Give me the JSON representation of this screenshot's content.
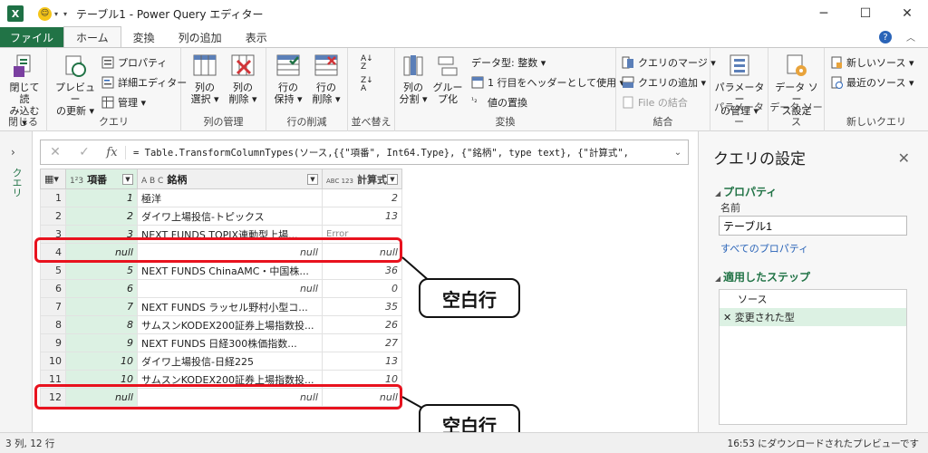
{
  "window": {
    "title": "テーブル1 - Power Query エディター",
    "min": "─",
    "max": "☐",
    "close": "✕"
  },
  "tabs": [
    {
      "label": "ファイル"
    },
    {
      "label": "ホーム"
    },
    {
      "label": "変換"
    },
    {
      "label": "列の追加"
    },
    {
      "label": "表示"
    }
  ],
  "help": "?",
  "ribbon": {
    "groups": {
      "close": "閉じる",
      "query": "クエリ",
      "manage_cols": "列の管理",
      "reduce_rows": "行の削減",
      "sort": "並べ替え",
      "transform": "変換",
      "combine": "結合",
      "params": "パラメーター",
      "datasource": "データ ソース",
      "newquery": "新しいクエリ"
    },
    "close_load": [
      "閉じて読",
      "み込む ▾"
    ],
    "preview": [
      "プレビュー",
      "の更新 ▾"
    ],
    "properties": "プロパティ",
    "advanced_editor": "詳細エディター",
    "manage": "管理 ▾",
    "choose_cols": [
      "列の",
      "選択 ▾"
    ],
    "remove_cols": [
      "列の",
      "削除 ▾"
    ],
    "keep_rows": [
      "行の",
      "保持 ▾"
    ],
    "remove_rows": [
      "行の",
      "削除 ▾"
    ],
    "split_col": [
      "列の",
      "分割 ▾"
    ],
    "group_by": [
      "グルー",
      "プ化"
    ],
    "data_type": "データ型: 整数 ▾",
    "first_row_header": "1 行目をヘッダーとして使用 ▾",
    "replace_values": "値の置換",
    "merge_queries": "クエリのマージ ▾",
    "append_queries": "クエリの追加 ▾",
    "combine_files": "File の結合",
    "manage_params": [
      "パラメーター",
      "の管理 ▾"
    ],
    "ds_settings": [
      "データ ソー",
      "ス設定"
    ],
    "new_source": "新しいソース ▾",
    "recent_sources": "最近のソース ▾"
  },
  "left_pane": {
    "label": "クエリ",
    "chevron": "›"
  },
  "formula": {
    "cancel": "✕",
    "confirm": "✓",
    "fx": "fx",
    "text": "= Table.TransformColumnTypes(ソース,{{\"項番\", Int64.Type}, {\"銘柄\", type text}, {\"計算式\",",
    "expand": "⌄"
  },
  "grid": {
    "columns": [
      {
        "type_icon": "1²3",
        "name": "項番"
      },
      {
        "type_icon": "A B C",
        "name": "銘柄"
      },
      {
        "type_icon": "ABC 123",
        "name": "計算式"
      }
    ],
    "rows": [
      {
        "n": "1",
        "a": "1",
        "b": "極洋",
        "c": "2"
      },
      {
        "n": "2",
        "a": "2",
        "b": "ダイワ上場投信-トピックス",
        "c": "13"
      },
      {
        "n": "3",
        "a": "3",
        "b": "NEXT FUNDS TOPIX連動型上場...",
        "c": "Error"
      },
      {
        "n": "4",
        "a": "null",
        "b": "null",
        "c": "null"
      },
      {
        "n": "5",
        "a": "5",
        "b": "NEXT FUNDS ChinaAMC・中国株...",
        "c": "36"
      },
      {
        "n": "6",
        "a": "6",
        "b": "null",
        "c": "0"
      },
      {
        "n": "7",
        "a": "7",
        "b": "NEXT FUNDS ラッセル野村小型コ...",
        "c": "35"
      },
      {
        "n": "8",
        "a": "8",
        "b": "サムスンKODEX200証券上場指数投...",
        "c": "26"
      },
      {
        "n": "9",
        "a": "9",
        "b": "NEXT FUNDS 日経300株価指数...",
        "c": "27"
      },
      {
        "n": "10",
        "a": "10",
        "b": "ダイワ上場投信-日経225",
        "c": "13"
      },
      {
        "n": "11",
        "a": "10",
        "b": "サムスンKODEX200証券上場指数投...",
        "c": "10"
      },
      {
        "n": "12",
        "a": "null",
        "b": "null",
        "c": "null"
      }
    ]
  },
  "annotations": {
    "callout1": "空白行",
    "callout2": "空白行"
  },
  "settings": {
    "title": "クエリの設定",
    "close": "✕",
    "properties_header": "プロパティ",
    "name_label": "名前",
    "name_value": "テーブル1",
    "all_properties": "すべてのプロパティ",
    "steps_header": "適用したステップ",
    "steps": [
      {
        "label": "ソース"
      },
      {
        "label": "✕ 変更された型"
      }
    ]
  },
  "status": {
    "left": "3 列, 12 行",
    "right": "16:53 にダウンロードされたプレビューです"
  }
}
